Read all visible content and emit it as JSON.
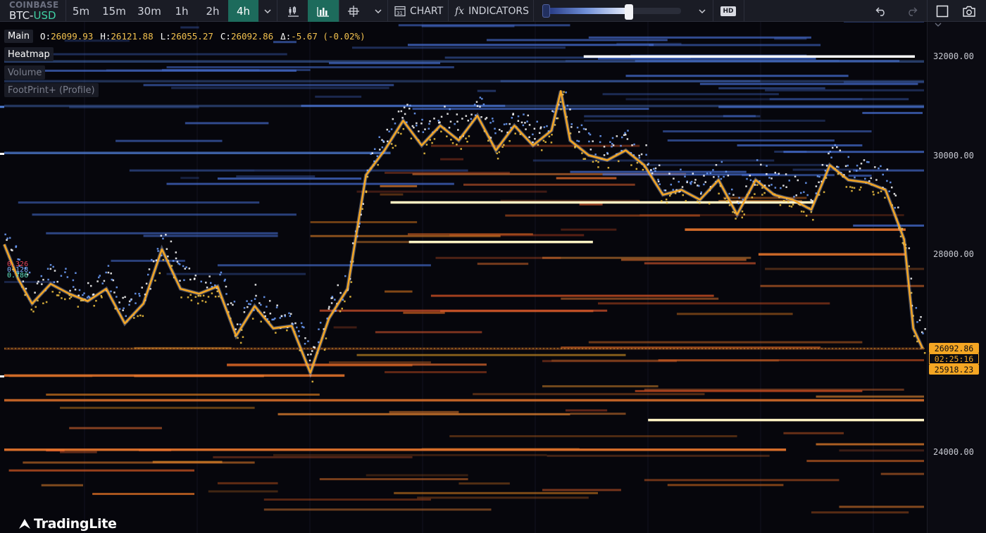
{
  "toolbar": {
    "exchange": "COINBASE",
    "pair_base": "BTC-",
    "pair_quote": "USD",
    "timeframes": [
      "5m",
      "15m",
      "30m",
      "1h",
      "2h",
      "4h"
    ],
    "active_timeframe": "4h",
    "chart_label": "CHART",
    "indicators_label": "INDICATORS",
    "hd_label": "HD",
    "slider_level": 0.61,
    "icons": [
      "chevron-down-icon",
      "candlestick-icon",
      "bar-chart-icon",
      "crosshair-icon",
      "chart-type-icon",
      "fx-icon",
      "undo-icon",
      "redo-icon",
      "square-icon",
      "camera-icon"
    ]
  },
  "legend": {
    "main_label": "Main",
    "open": "26099.93",
    "high": "26121.88",
    "low": "26055.27",
    "close": "26092.86",
    "change": "-5.67 (-0.02%)",
    "open_key": "O:",
    "high_key": "H:",
    "low_key": "L:",
    "close_key": "C:",
    "change_key": "Δ:"
  },
  "layers": {
    "heatmap": "Heatmap",
    "volume": "Volume",
    "footprint": "FootPrint+ (Profile)"
  },
  "side_values": {
    "a": "0.326",
    "b": "0.128",
    "c": "0.786"
  },
  "price_axis": {
    "ticks": [
      "32000.00",
      "30000.00",
      "28000.00",
      "24000.00"
    ],
    "last_price": "26092.86",
    "countdown": "02:25:16",
    "low_price": "25918.23"
  },
  "brand": {
    "name": "TradingLite"
  },
  "colors": {
    "accent": "#1d6b5c",
    "price_line": "#f5a623",
    "ask_blue": "#4f7ed6",
    "bid_orange": "#e06a2c",
    "background": "#06060c"
  },
  "chart_data": {
    "type": "heatmap",
    "title": "",
    "y_axis": {
      "ticks": [
        24000,
        28000,
        30000,
        32000
      ],
      "range": [
        22800,
        32800
      ]
    },
    "price_series": [
      {
        "bar": 0,
        "price": 28200
      },
      {
        "bar": 3,
        "price": 27500
      },
      {
        "bar": 6,
        "price": 27000
      },
      {
        "bar": 10,
        "price": 27400
      },
      {
        "bar": 14,
        "price": 27200
      },
      {
        "bar": 18,
        "price": 27050
      },
      {
        "bar": 22,
        "price": 27300
      },
      {
        "bar": 26,
        "price": 26600
      },
      {
        "bar": 30,
        "price": 27000
      },
      {
        "bar": 34,
        "price": 28100
      },
      {
        "bar": 38,
        "price": 27300
      },
      {
        "bar": 42,
        "price": 27200
      },
      {
        "bar": 46,
        "price": 27350
      },
      {
        "bar": 50,
        "price": 26350
      },
      {
        "bar": 54,
        "price": 26950
      },
      {
        "bar": 58,
        "price": 26500
      },
      {
        "bar": 62,
        "price": 26550
      },
      {
        "bar": 66,
        "price": 25600
      },
      {
        "bar": 70,
        "price": 26700
      },
      {
        "bar": 74,
        "price": 27300
      },
      {
        "bar": 78,
        "price": 29600
      },
      {
        "bar": 82,
        "price": 30100
      },
      {
        "bar": 86,
        "price": 30700
      },
      {
        "bar": 90,
        "price": 30200
      },
      {
        "bar": 94,
        "price": 30600
      },
      {
        "bar": 98,
        "price": 30300
      },
      {
        "bar": 102,
        "price": 30800
      },
      {
        "bar": 106,
        "price": 30100
      },
      {
        "bar": 110,
        "price": 30600
      },
      {
        "bar": 114,
        "price": 30200
      },
      {
        "bar": 118,
        "price": 30500
      },
      {
        "bar": 120,
        "price": 31300
      },
      {
        "bar": 122,
        "price": 30300
      },
      {
        "bar": 126,
        "price": 30000
      },
      {
        "bar": 130,
        "price": 29900
      },
      {
        "bar": 134,
        "price": 30100
      },
      {
        "bar": 138,
        "price": 29800
      },
      {
        "bar": 142,
        "price": 29200
      },
      {
        "bar": 146,
        "price": 29300
      },
      {
        "bar": 150,
        "price": 29100
      },
      {
        "bar": 154,
        "price": 29500
      },
      {
        "bar": 158,
        "price": 28800
      },
      {
        "bar": 162,
        "price": 29500
      },
      {
        "bar": 166,
        "price": 29200
      },
      {
        "bar": 170,
        "price": 29100
      },
      {
        "bar": 174,
        "price": 28900
      },
      {
        "bar": 178,
        "price": 29800
      },
      {
        "bar": 182,
        "price": 29500
      },
      {
        "bar": 186,
        "price": 29450
      },
      {
        "bar": 190,
        "price": 29300
      },
      {
        "bar": 194,
        "price": 28300
      },
      {
        "bar": 196,
        "price": 26500
      },
      {
        "bar": 198,
        "price": 26092
      }
    ],
    "liquidity_bands": [
      {
        "side": "ask",
        "price": 32000,
        "from": 0.63,
        "to": 0.99,
        "intensity": 1.0
      },
      {
        "side": "ask",
        "price": 31900,
        "from": 0.0,
        "to": 1.0,
        "intensity": 0.45
      },
      {
        "side": "ask",
        "price": 31500,
        "from": 0.0,
        "to": 1.0,
        "intensity": 0.35
      },
      {
        "side": "ask",
        "price": 31000,
        "from": 0.0,
        "to": 1.0,
        "intensity": 0.4
      },
      {
        "side": "ask",
        "price": 30050,
        "from": 0.0,
        "to": 0.42,
        "intensity": 0.75
      },
      {
        "side": "bid",
        "price": 29050,
        "from": 0.42,
        "to": 0.88,
        "intensity": 1.0
      },
      {
        "side": "bid",
        "price": 28500,
        "from": 0.74,
        "to": 0.98,
        "intensity": 0.9
      },
      {
        "side": "bid",
        "price": 28250,
        "from": 0.44,
        "to": 0.64,
        "intensity": 0.95
      },
      {
        "side": "bid",
        "price": 28000,
        "from": 0.82,
        "to": 0.98,
        "intensity": 0.85
      },
      {
        "side": "bid",
        "price": 26092,
        "from": 0.0,
        "to": 1.0,
        "intensity": 0.3
      },
      {
        "side": "bid",
        "price": 25550,
        "from": 0.0,
        "to": 0.37,
        "intensity": 0.85
      },
      {
        "side": "bid",
        "price": 25050,
        "from": 0.0,
        "to": 1.0,
        "intensity": 0.8
      },
      {
        "side": "bid",
        "price": 24650,
        "from": 0.7,
        "to": 1.0,
        "intensity": 0.95
      },
      {
        "side": "bid",
        "price": 24050,
        "from": 0.0,
        "to": 0.85,
        "intensity": 0.9
      }
    ]
  }
}
